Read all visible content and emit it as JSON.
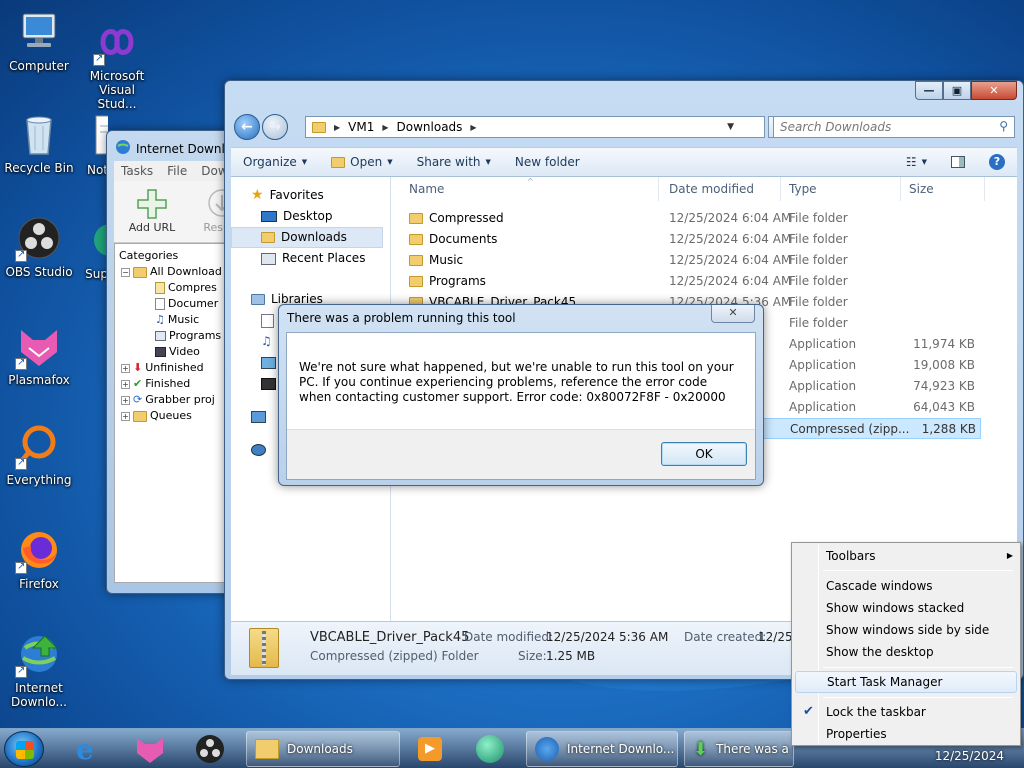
{
  "desktop": {
    "icons": [
      {
        "label": "Computer"
      },
      {
        "label": "Microsoft Visual Stud..."
      },
      {
        "label": "Recycle Bin"
      },
      {
        "label": "Not"
      },
      {
        "label": "OBS Studio"
      },
      {
        "label": "Sup"
      },
      {
        "label": "Plasmafox"
      },
      {
        "label": "Everything"
      },
      {
        "label": "Firefox"
      },
      {
        "label": "Internet Downlo..."
      }
    ]
  },
  "idm": {
    "title": "Internet Downlo",
    "menu": [
      "Tasks",
      "File",
      "Down"
    ],
    "toolbar": {
      "add_url": "Add URL",
      "resume": "Resum"
    },
    "tree": [
      {
        "label": "Categories"
      },
      {
        "label": "All Download"
      },
      {
        "label": "Compres"
      },
      {
        "label": "Documer"
      },
      {
        "label": "Music"
      },
      {
        "label": "Programs"
      },
      {
        "label": "Video"
      },
      {
        "label": "Unfinished"
      },
      {
        "label": "Finished"
      },
      {
        "label": "Grabber proj"
      },
      {
        "label": "Queues"
      }
    ]
  },
  "explorer": {
    "breadcrumb": [
      "VM1",
      "Downloads"
    ],
    "search_placeholder": "Search Downloads",
    "commands": {
      "organize": "Organize",
      "open": "Open",
      "share_with": "Share with",
      "new_folder": "New folder"
    },
    "nav": {
      "favorites": "Favorites",
      "desktop": "Desktop",
      "downloads": "Downloads",
      "recent": "Recent Places",
      "libraries": "Libraries"
    },
    "columns": {
      "name": "Name",
      "date": "Date modified",
      "type": "Type",
      "size": "Size"
    },
    "files": [
      {
        "name": "Compressed",
        "date": "12/25/2024 6:04 AM",
        "type": "File folder",
        "size": ""
      },
      {
        "name": "Documents",
        "date": "12/25/2024 6:04 AM",
        "type": "File folder",
        "size": ""
      },
      {
        "name": "Music",
        "date": "12/25/2024 6:04 AM",
        "type": "File folder",
        "size": ""
      },
      {
        "name": "Programs",
        "date": "12/25/2024 6:04 AM",
        "type": "File folder",
        "size": ""
      },
      {
        "name": "VBCABLE_Driver_Pack45",
        "date": "12/25/2024 5:36 AM",
        "type": "File folder",
        "size": ""
      },
      {
        "name": "",
        "date": "",
        "type": "File folder",
        "size": ""
      },
      {
        "name": "",
        "date": "",
        "type": "Application",
        "size": "11,974 KB"
      },
      {
        "name": "",
        "date": "",
        "type": "Application",
        "size": "19,008 KB"
      },
      {
        "name": "",
        "date": "",
        "type": "Application",
        "size": "74,923 KB"
      },
      {
        "name": "",
        "date": "",
        "type": "Application",
        "size": "64,043 KB"
      },
      {
        "name": "",
        "date": "",
        "type": "Compressed (zipp...",
        "size": "1,288 KB"
      }
    ],
    "details": {
      "name": "VBCABLE_Driver_Pack45",
      "kind": "Compressed (zipped) Folder",
      "date_modified_label": "Date modified:",
      "date_modified": "12/25/2024 5:36 AM",
      "size_label": "Size:",
      "size": "1.25 MB",
      "date_created_label": "Date created:",
      "date_created": "12/25/"
    }
  },
  "dialog": {
    "title": "There was a problem running this tool",
    "message": "We're not sure what happened, but we're unable to run this tool on your PC. If you continue experiencing problems, reference the error code when contacting customer support. Error code: 0x80072F8F - 0x20000",
    "ok": "OK"
  },
  "taskbar": {
    "tasks": [
      {
        "label": "Downloads"
      },
      {
        "label": "Internet Downlo..."
      },
      {
        "label": "There was a probl..."
      }
    ],
    "date": "12/25/2024"
  },
  "context_menu": {
    "toolbars": "Toolbars",
    "cascade": "Cascade windows",
    "stacked": "Show windows stacked",
    "side_by_side": "Show windows side by side",
    "show_desktop": "Show the desktop",
    "task_manager": "Start Task Manager",
    "lock": "Lock the taskbar",
    "properties": "Properties"
  },
  "colors": {
    "accent": "#1c6fc4",
    "selection": "#cce8ff",
    "menu_bg": "#f0f0f0"
  }
}
